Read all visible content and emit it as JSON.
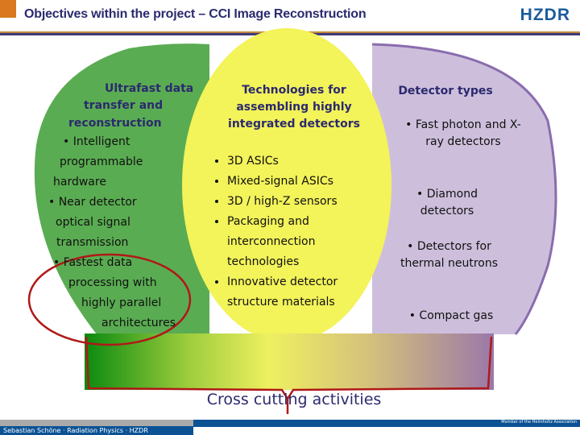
{
  "header": {
    "title": "Objectives within the project – CCI Image Reconstruction",
    "logo": "HZDR"
  },
  "green": {
    "items": [
      "Ultrafast data",
      "transfer and",
      "reconstruction",
      "• Intelligent",
      "programmable",
      "hardware",
      "• Near detector",
      "optical signal",
      "transmission",
      "• Fastest data",
      "processing with",
      "highly parallel",
      "architectures"
    ]
  },
  "yellow": {
    "heading": [
      "Technologies for",
      "assembling highly",
      "integrated detectors"
    ],
    "bullets": [
      "3D ASICs",
      "Mixed-signal ASICs",
      "3D / high-Z sensors",
      "Packaging and interconnection technologies",
      "Innovative detector structure materials"
    ]
  },
  "purple": {
    "heading": "Detector types",
    "items": [
      "• Fast photon and X-ray detectors",
      "• Diamond detectors",
      "• Detectors for thermal neutrons",
      "• Compact gas detectors"
    ]
  },
  "bottom": {
    "label": "Cross cutting activities"
  },
  "footer": {
    "author": "Sebastian Schöne · Radiation Physics · HZDR",
    "association": "Member of the Helmholtz Association"
  },
  "colors": {
    "accent": "#d9781e",
    "title": "#2b2a6e",
    "green": "#5aac52",
    "yellow": "#f3f35a",
    "purple": "#cdbfdc",
    "red": "#b01818"
  }
}
